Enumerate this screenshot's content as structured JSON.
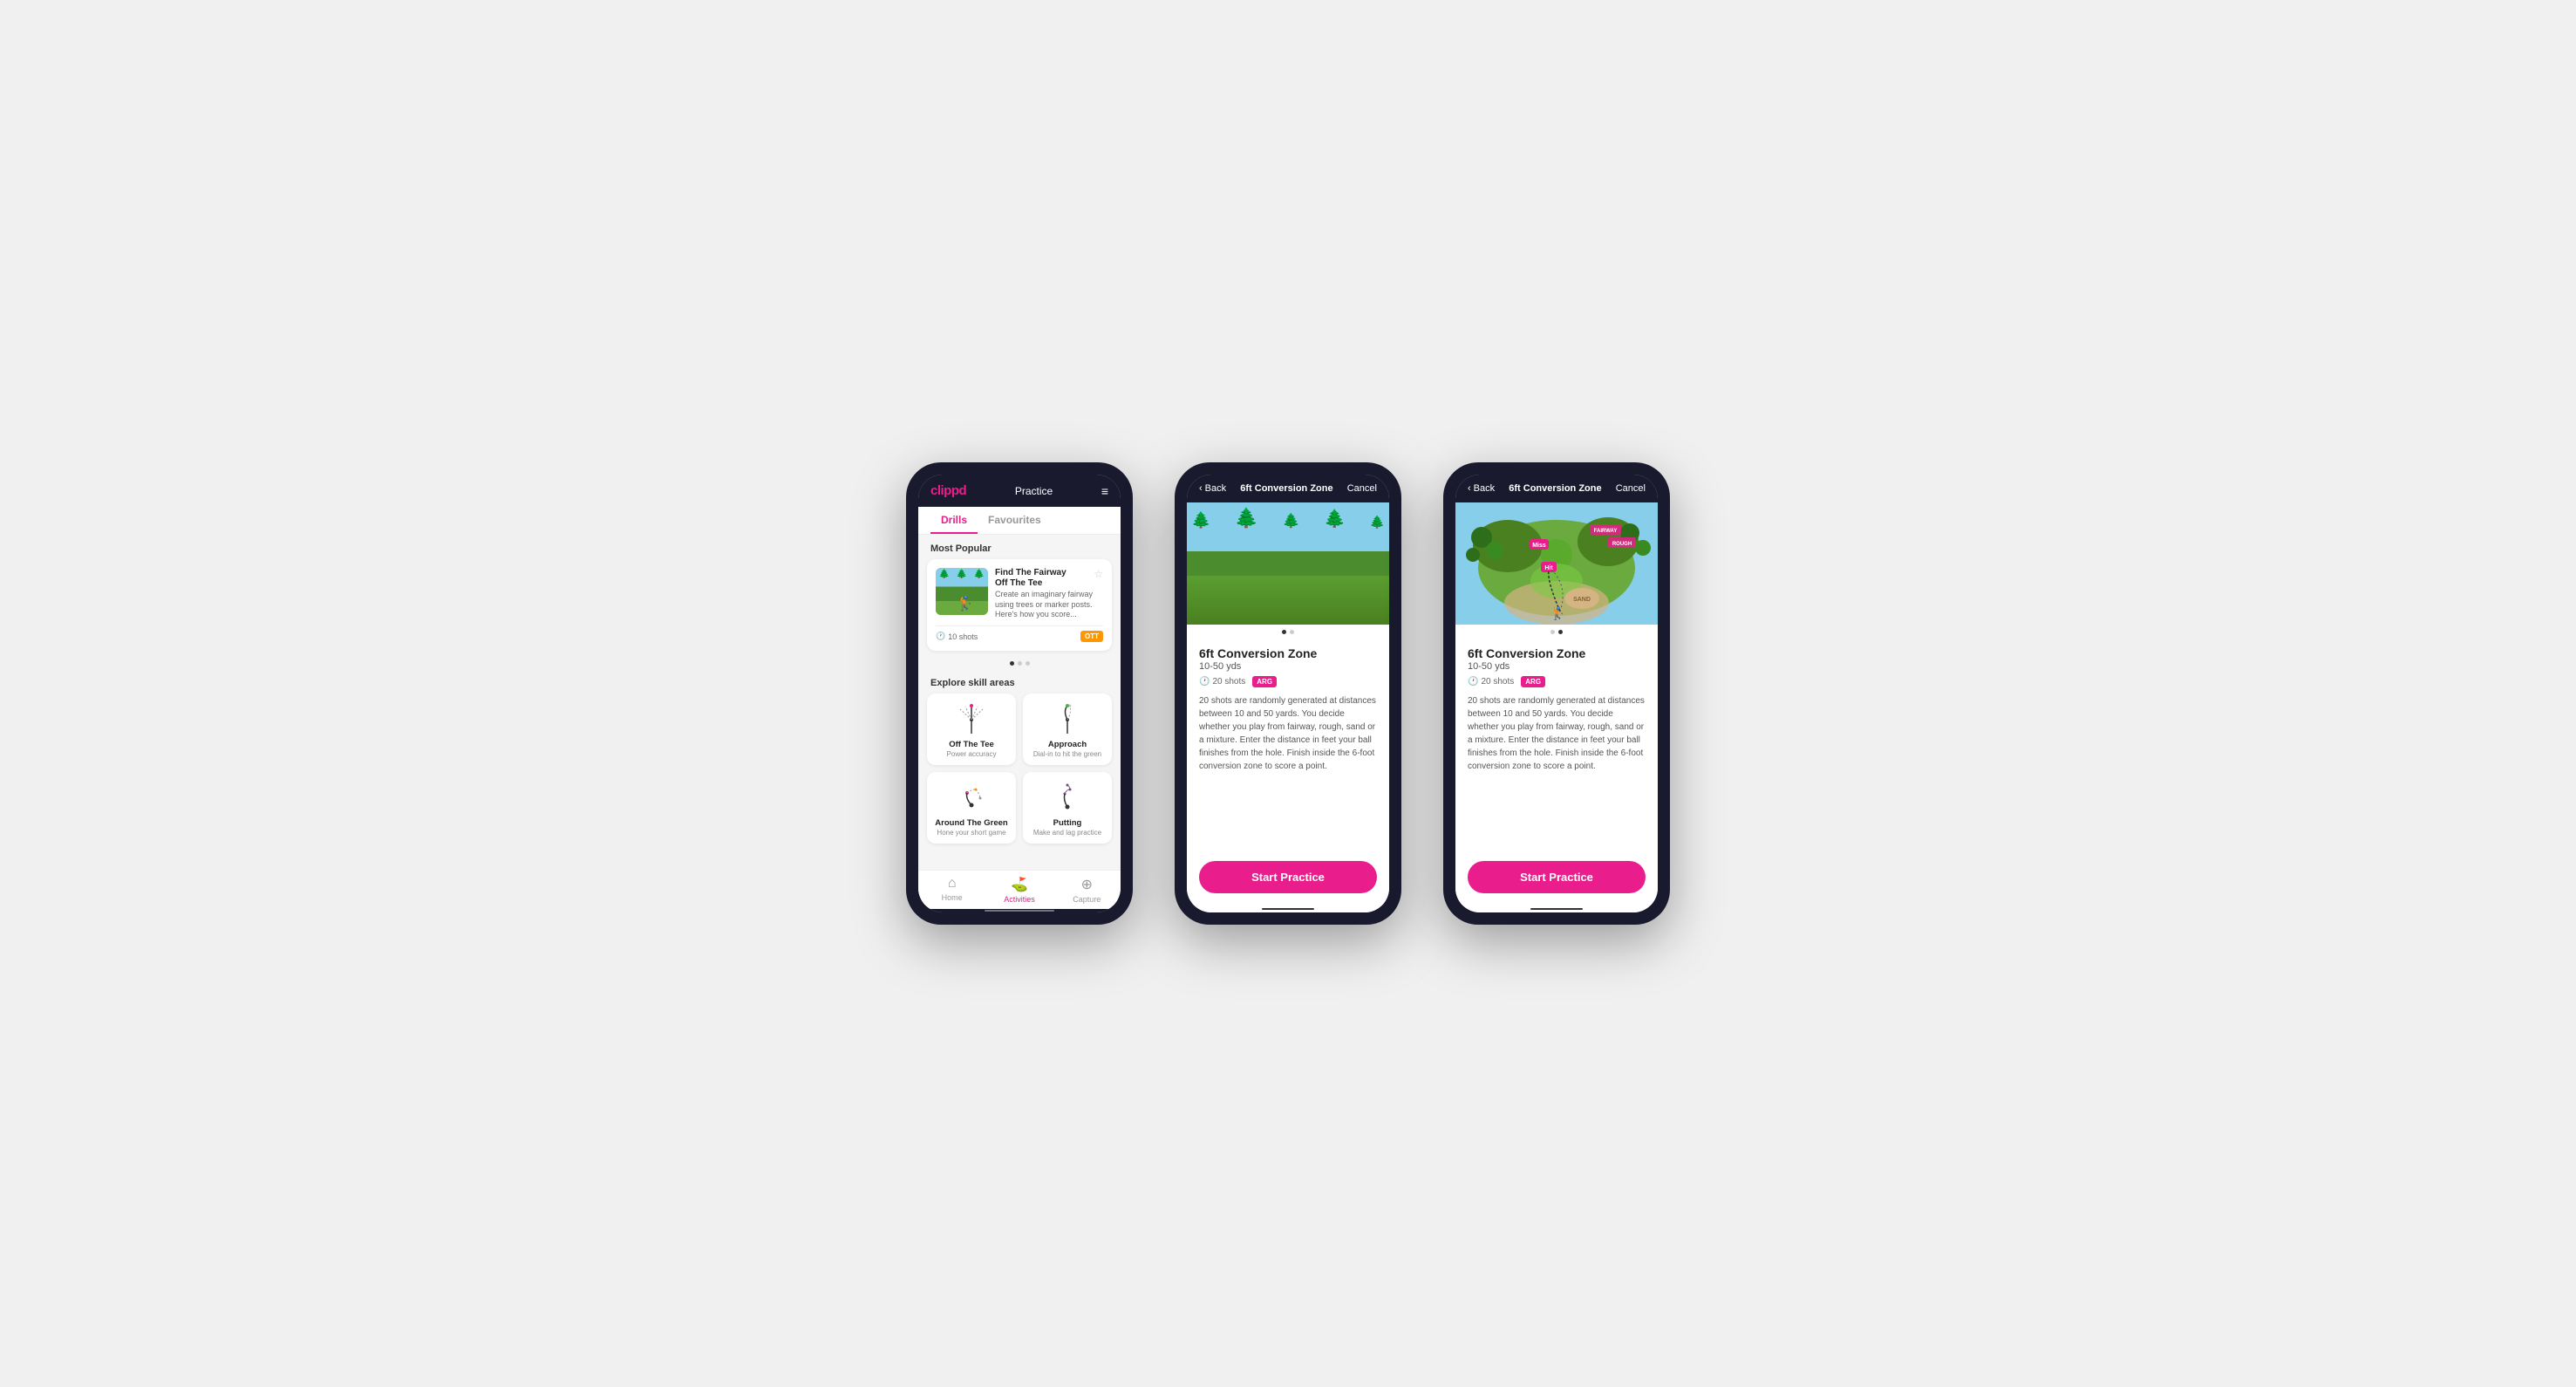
{
  "phones": {
    "phone1": {
      "header": {
        "logo": "clippd",
        "title": "Practice",
        "menu_icon": "≡"
      },
      "tabs": [
        {
          "label": "Drills",
          "active": true
        },
        {
          "label": "Favourites",
          "active": false
        }
      ],
      "most_popular": {
        "section_title": "Most Popular",
        "card": {
          "title": "Find The Fairway",
          "subtitle": "Off The Tee",
          "description": "Create an imaginary fairway using trees or marker posts. Here's how you score...",
          "shots": "10 shots",
          "badge": "OTT"
        }
      },
      "explore": {
        "section_title": "Explore skill areas",
        "items": [
          {
            "name": "Off The Tee",
            "desc": "Power accuracy"
          },
          {
            "name": "Approach",
            "desc": "Dial-in to hit the green"
          },
          {
            "name": "Around The Green",
            "desc": "Hone your short game"
          },
          {
            "name": "Putting",
            "desc": "Make and lag practice"
          }
        ]
      },
      "nav": [
        {
          "label": "Home",
          "icon": "⌂",
          "active": false
        },
        {
          "label": "Activities",
          "icon": "⛳",
          "active": true
        },
        {
          "label": "Capture",
          "icon": "⊕",
          "active": false
        }
      ]
    },
    "phone2": {
      "header": {
        "back_label": "Back",
        "title": "6ft Conversion Zone",
        "cancel_label": "Cancel"
      },
      "drill": {
        "title": "6ft Conversion Zone",
        "distance": "10-50 yds",
        "shots": "20 shots",
        "badge": "ARG",
        "description": "20 shots are randomly generated at distances between 10 and 50 yards. You decide whether you play from fairway, rough, sand or a mixture. Enter the distance in feet your ball finishes from the hole. Finish inside the 6-foot conversion zone to score a point.",
        "start_button": "Start Practice"
      },
      "dots": [
        {
          "active": true
        },
        {
          "active": false
        }
      ]
    },
    "phone3": {
      "header": {
        "back_label": "Back",
        "title": "6ft Conversion Zone",
        "cancel_label": "Cancel"
      },
      "drill": {
        "title": "6ft Conversion Zone",
        "distance": "10-50 yds",
        "shots": "20 shots",
        "badge": "ARG",
        "description": "20 shots are randomly generated at distances between 10 and 50 yards. You decide whether you play from fairway, rough, sand or a mixture. Enter the distance in feet your ball finishes from the hole. Finish inside the 6-foot conversion zone to score a point.",
        "start_button": "Start Practice"
      },
      "dots": [
        {
          "active": false
        },
        {
          "active": true
        }
      ]
    }
  }
}
